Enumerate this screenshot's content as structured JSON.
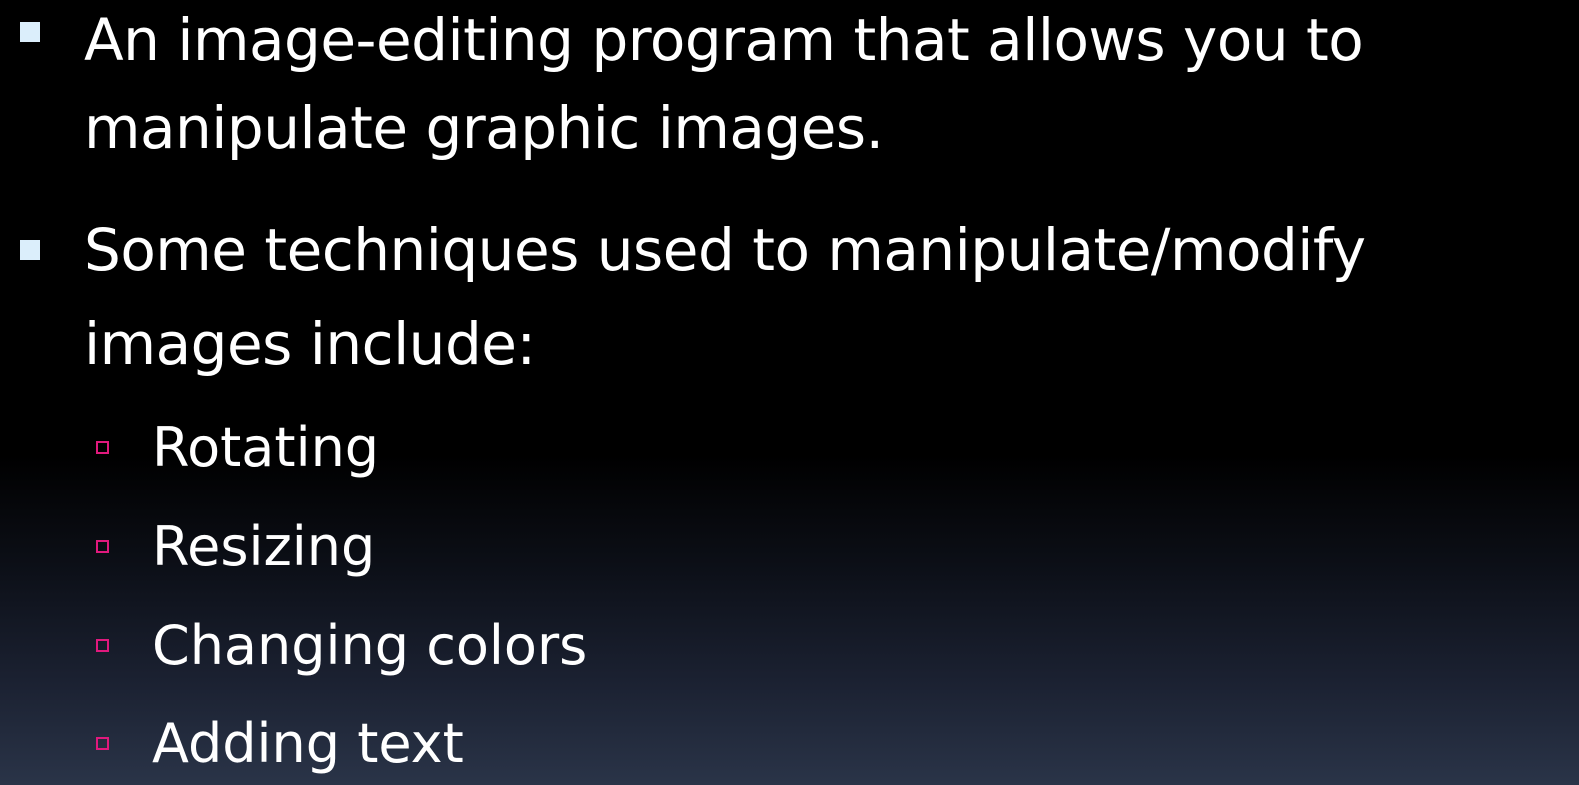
{
  "slide": {
    "bullets": [
      {
        "text_line1": "An image-editing program that allows you to",
        "text_line2": "manipulate graphic images."
      },
      {
        "text_line1": "Some techniques used to manipulate/modify",
        "text_line2": "images include:"
      }
    ],
    "sub_bullets": [
      {
        "text": "Rotating"
      },
      {
        "text": "Resizing"
      },
      {
        "text": "Changing colors"
      },
      {
        "text": "Adding text"
      }
    ]
  },
  "colors": {
    "primary_bullet": "#dbeefb",
    "sub_bullet": "#e0197d",
    "text": "#ffffff"
  }
}
